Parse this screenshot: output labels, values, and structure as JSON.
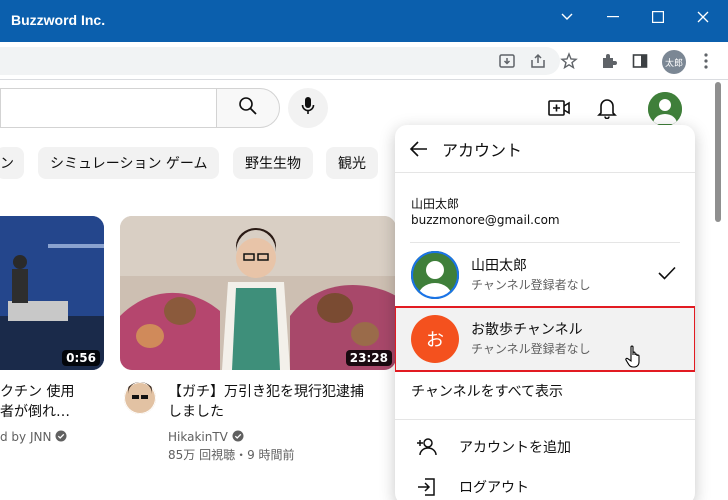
{
  "window": {
    "title": "Buzzword Inc."
  },
  "toolbar": {
    "profile_chip": "太郎"
  },
  "header": {
    "icons": [
      "search-icon",
      "mic-icon",
      "create-video-icon",
      "bell-icon"
    ]
  },
  "chips": [
    "ン",
    "シミュレーション ゲーム",
    "野生生物",
    "観光"
  ],
  "videos": [
    {
      "duration": "0:56",
      "title_line1": "クチン 使用",
      "title_line2": "者が倒れ…",
      "channel": "d by JNN"
    },
    {
      "duration": "23:28",
      "title_line1": "【ガチ】万引き犯を現行犯逮捕",
      "title_line2": "しました",
      "channel": "HikakinTV",
      "meta": "85万 回視聴・9 時間前"
    }
  ],
  "account_panel": {
    "title": "アカウント",
    "user_name": "山田太郎",
    "user_email": "buzzmonore@gmail.com",
    "accounts": [
      {
        "name": "山田太郎",
        "subtitle": "チャンネル登録者なし",
        "checked": true
      },
      {
        "name": "お散歩チャンネル",
        "subtitle": "チャンネル登録者なし",
        "avatar_letter": "お",
        "avatar_color": "#f4511e"
      }
    ],
    "view_all_channels": "チャンネルをすべて表示",
    "add_account": "アカウントを追加",
    "logout": "ログアウト"
  },
  "colors": {
    "titlebar": "#0b5fad",
    "highlight_border": "#e21b22"
  }
}
